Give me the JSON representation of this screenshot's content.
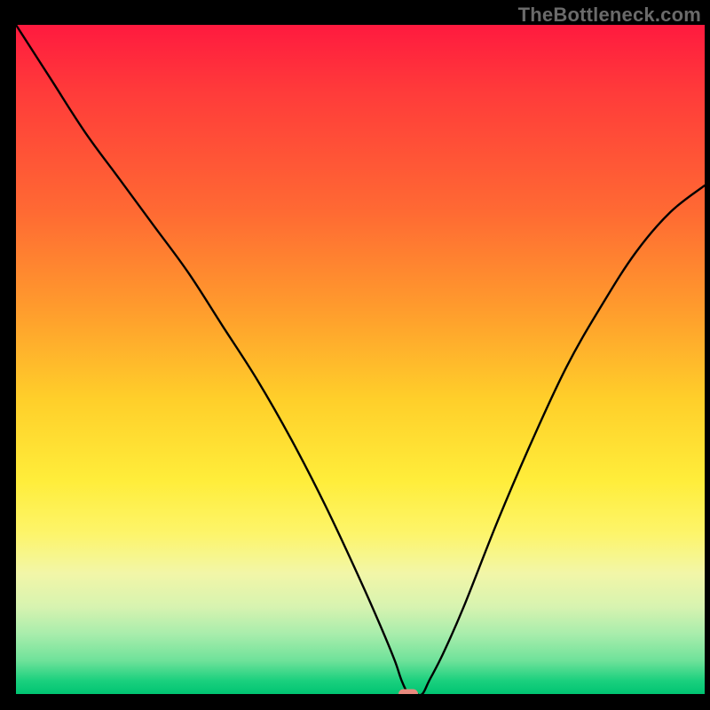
{
  "watermark": "TheBottleneck.com",
  "chart_data": {
    "type": "line",
    "title": "",
    "xlabel": "",
    "ylabel": "",
    "xlim": [
      0,
      100
    ],
    "ylim": [
      0,
      100
    ],
    "grid": false,
    "legend": false,
    "background": "red-to-green vertical gradient (bottleneck heatmap)",
    "series": [
      {
        "name": "bottleneck-curve",
        "x": [
          0,
          5,
          10,
          15,
          20,
          25,
          30,
          35,
          40,
          45,
          50,
          53,
          55,
          56,
          57,
          58,
          59,
          60,
          62,
          65,
          70,
          75,
          80,
          85,
          90,
          95,
          100
        ],
        "y": [
          100,
          92,
          84,
          77,
          70,
          63,
          55,
          47,
          38,
          28,
          17,
          10,
          5,
          2,
          0,
          0,
          0,
          2,
          6,
          13,
          26,
          38,
          49,
          58,
          66,
          72,
          76
        ]
      }
    ],
    "min_point": {
      "x": 57,
      "y": 0
    },
    "min_marker_color": "#e88a7e",
    "curve_color": "#000000"
  }
}
